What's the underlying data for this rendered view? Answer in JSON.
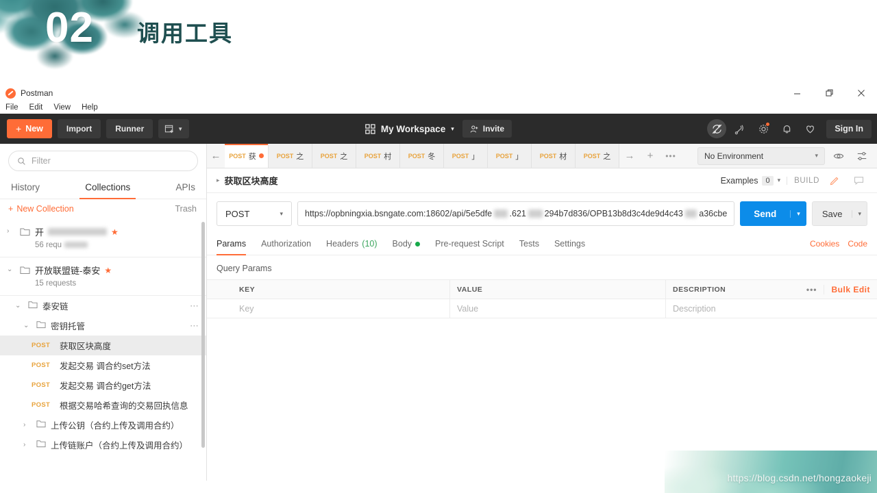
{
  "slide": {
    "number": "02",
    "title": "调用工具",
    "watermark": "https://blog.csdn.net/hongzaokeji"
  },
  "window": {
    "app_title": "Postman",
    "logo_icon": "postman-logo-icon",
    "minimize_icon": "minimize-icon",
    "restore_icon": "restore-icon",
    "close_icon": "close-icon"
  },
  "menu": {
    "items": [
      {
        "label": "File"
      },
      {
        "label": "Edit"
      },
      {
        "label": "View"
      },
      {
        "label": "Help"
      }
    ]
  },
  "toolbar": {
    "new_label": "New",
    "new_plus": "+",
    "import_label": "Import",
    "runner_label": "Runner",
    "new_tab_icon": "new-window-icon",
    "workspace_icon": "grid-icon",
    "workspace_label": "My Workspace",
    "workspace_caret": "▾",
    "invite_icon": "person-add-icon",
    "invite_label": "Invite",
    "sync_icon": "sync-disabled-icon",
    "broadcast_icon": "satellite-icon",
    "settings_icon": "gear-icon",
    "notifications_icon": "bell-icon",
    "favorites_icon": "heart-icon",
    "sign_in_label": "Sign In"
  },
  "sidebar": {
    "filter_placeholder": "Filter",
    "search_icon": "search-icon",
    "tabs": [
      {
        "label": "History",
        "active": false
      },
      {
        "label": "Collections",
        "active": true
      },
      {
        "label": "APIs",
        "active": false
      }
    ],
    "new_collection_label": "New Collection",
    "new_collection_plus": "+",
    "trash_label": "Trash",
    "collections": [
      {
        "name_visible": "开",
        "name_redacted": true,
        "requests_label": "56 requ",
        "requests_redacted": true,
        "starred": true,
        "star_glyph": "★",
        "expanded": false,
        "chevron": "›"
      },
      {
        "name_visible": "开放联盟链-泰安",
        "name_redacted": false,
        "requests_label": "15 requests",
        "requests_redacted": false,
        "starred": true,
        "star_glyph": "★",
        "expanded": true,
        "chevron": "⌄"
      }
    ],
    "tree": [
      {
        "type": "folder",
        "label": "泰安链",
        "indent": 22,
        "chevron": "⌄",
        "kebab": "⋯"
      },
      {
        "type": "folder",
        "label": "密钥托管",
        "indent": 34,
        "chevron": "⌄",
        "kebab": "⋯"
      },
      {
        "type": "request",
        "method": "POST",
        "label": "获取区块高度",
        "indent": 46,
        "selected": true
      },
      {
        "type": "request",
        "method": "POST",
        "label": "发起交易 调合约set方法",
        "indent": 46,
        "selected": false
      },
      {
        "type": "request",
        "method": "POST",
        "label": "发起交易 调合约get方法",
        "indent": 46,
        "selected": false
      },
      {
        "type": "request",
        "method": "POST",
        "label": "根据交易哈希查询的交易回执信息",
        "indent": 46,
        "selected": false
      },
      {
        "type": "folder",
        "label": "上传公钥（合约上传及调用合约）",
        "indent": 34,
        "chevron": "›",
        "kebab": ""
      },
      {
        "type": "folder",
        "label": "上传链账户（合约上传及调用合约）",
        "indent": 34,
        "chevron": "›",
        "kebab": ""
      }
    ]
  },
  "main": {
    "back_icon": "arrow-left-icon",
    "forward_icon": "arrow-right-icon",
    "add_tab_icon": "plus-icon",
    "more_tabs_icon": "ellipsis-icon",
    "request_tabs": [
      {
        "method": "POST",
        "title": "获",
        "active": true,
        "unsaved": true
      },
      {
        "method": "POST",
        "title": "之",
        "active": false,
        "unsaved": false
      },
      {
        "method": "POST",
        "title": "之",
        "active": false,
        "unsaved": false
      },
      {
        "method": "POST",
        "title": "村",
        "active": false,
        "unsaved": false
      },
      {
        "method": "POST",
        "title": "冬",
        "active": false,
        "unsaved": false
      },
      {
        "method": "POST",
        "title": "」",
        "active": false,
        "unsaved": false
      },
      {
        "method": "POST",
        "title": "」",
        "active": false,
        "unsaved": false
      },
      {
        "method": "POST",
        "title": "材",
        "active": false,
        "unsaved": false
      },
      {
        "method": "POST",
        "title": "之",
        "active": false,
        "unsaved": false
      }
    ],
    "environment": {
      "selected": "No Environment",
      "caret": "▾",
      "eye_icon": "eye-icon",
      "settings_icon": "sliders-icon"
    },
    "request_name": "获取区块高度",
    "request_name_triangle": "▸",
    "examples_label": "Examples",
    "examples_count": "0",
    "examples_caret": "▾",
    "build_label": "BUILD",
    "edit_icon": "pencil-icon",
    "comment_icon": "comment-icon",
    "method": "POST",
    "method_caret": "▾",
    "url_parts": [
      {
        "text": "https://opbningxia.bsngate.com:18602/api/5e5dfe",
        "redacted": false
      },
      {
        "text": "",
        "redacted": true,
        "width": 58
      },
      {
        "text": ".621",
        "redacted": false
      },
      {
        "text": "",
        "redacted": true,
        "width": 62
      },
      {
        "text": "294b7d836/OPB13b8d3c4de9d4c43",
        "redacted": false
      },
      {
        "text": "",
        "redacted": true,
        "width": 52
      },
      {
        "text": "a36cbe",
        "redacted": false
      }
    ],
    "send_label": "Send",
    "send_caret": "▾",
    "save_label": "Save",
    "save_caret": "▾",
    "request_tabs_row": [
      {
        "label": "Params",
        "active": true
      },
      {
        "label": "Authorization",
        "active": false
      },
      {
        "label": "Headers",
        "count": "(10)",
        "active": false
      },
      {
        "label": "Body",
        "dot": true,
        "active": false
      },
      {
        "label": "Pre-request Script",
        "active": false
      },
      {
        "label": "Tests",
        "active": false
      },
      {
        "label": "Settings",
        "active": false
      }
    ],
    "cookies_link": "Cookies",
    "code_link": "Code",
    "query_params_title": "Query Params",
    "params_table": {
      "headers": {
        "key": "KEY",
        "value": "VALUE",
        "description": "DESCRIPTION"
      },
      "rows": [
        {
          "key": "Key",
          "value": "Value",
          "description": "Description"
        }
      ],
      "dots": "•••",
      "bulk_edit": "Bulk Edit"
    }
  }
}
